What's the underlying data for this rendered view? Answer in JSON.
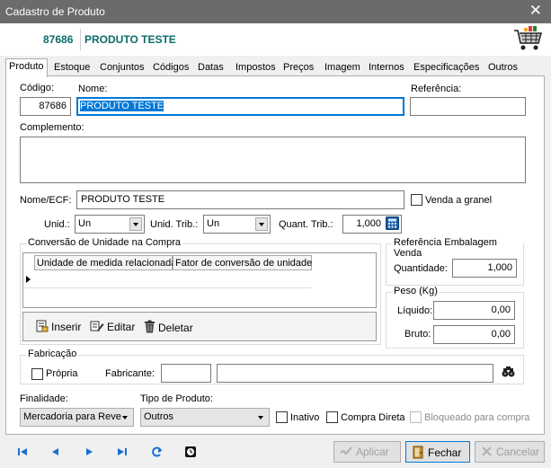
{
  "window": {
    "title": "Cadastro de Produto",
    "close_symbol": "✕"
  },
  "header": {
    "code": "87686",
    "name": "PRODUTO TESTE"
  },
  "tabs": [
    {
      "label": "Produto",
      "active": true
    },
    {
      "label": "Estoque"
    },
    {
      "label": "Conjuntos"
    },
    {
      "label": "Códigos"
    },
    {
      "label": "Datas"
    },
    {
      "label": "Impostos"
    },
    {
      "label": "Preços"
    },
    {
      "label": "Imagem"
    },
    {
      "label": "Internos"
    },
    {
      "label": "Especificações"
    },
    {
      "label": "Outros"
    }
  ],
  "form": {
    "codigo_label": "Código:",
    "codigo_value": "87686",
    "nome_label": "Nome:",
    "nome_value": "PRODUTO TESTE",
    "referencia_label": "Referência:",
    "referencia_value": "",
    "complemento_label": "Complemento:",
    "complemento_value": "",
    "nome_ecf_label": "Nome/ECF:",
    "nome_ecf_value": "PRODUTO TESTE",
    "venda_granel_label": "Venda a granel",
    "unid_label": "Unid.:",
    "unid_value": "Un",
    "unid_trib_label": "Unid. Trib.:",
    "unid_trib_value": "Un",
    "quant_trib_label": "Quant. Trib.:",
    "quant_trib_value": "1,000"
  },
  "conversao": {
    "title": "Conversão de Unidade na Compra",
    "columns": [
      "Unidade de medida relacionada",
      "Fator de conversão de unidade"
    ],
    "buttons": {
      "inserir": "Inserir",
      "editar": "Editar",
      "deletar": "Deletar"
    }
  },
  "referencia_embalagem": {
    "title": "Referência Embalagem Venda",
    "quantidade_label": "Quantidade:",
    "quantidade_value": "1,000"
  },
  "peso": {
    "title": "Peso (Kg)",
    "liquido_label": "Líquido:",
    "liquido_value": "0,00",
    "bruto_label": "Bruto:",
    "bruto_value": "0,00"
  },
  "fabricacao": {
    "title": "Fabricação",
    "propria_label": "Própria",
    "fabricante_label": "Fabricante:",
    "fabricante_code": "",
    "fabricante_name": ""
  },
  "bottom": {
    "finalidade_label": "Finalidade:",
    "finalidade_value": "Mercadoria para Reve",
    "tipo_label": "Tipo de Produto:",
    "tipo_value": "Outros",
    "inativo_label": "Inativo",
    "compra_direta_label": "Compra Direta",
    "bloqueado_label": "Bloqueado para compra"
  },
  "footer": {
    "aplicar": "Aplicar",
    "fechar": "Fechar",
    "cancelar": "Cancelar"
  },
  "colors": {
    "accent": "#0078d7",
    "header_text": "#0b6b6b",
    "titlebar": "#6b6b6b",
    "nav_blue": "#1b6fd1"
  }
}
